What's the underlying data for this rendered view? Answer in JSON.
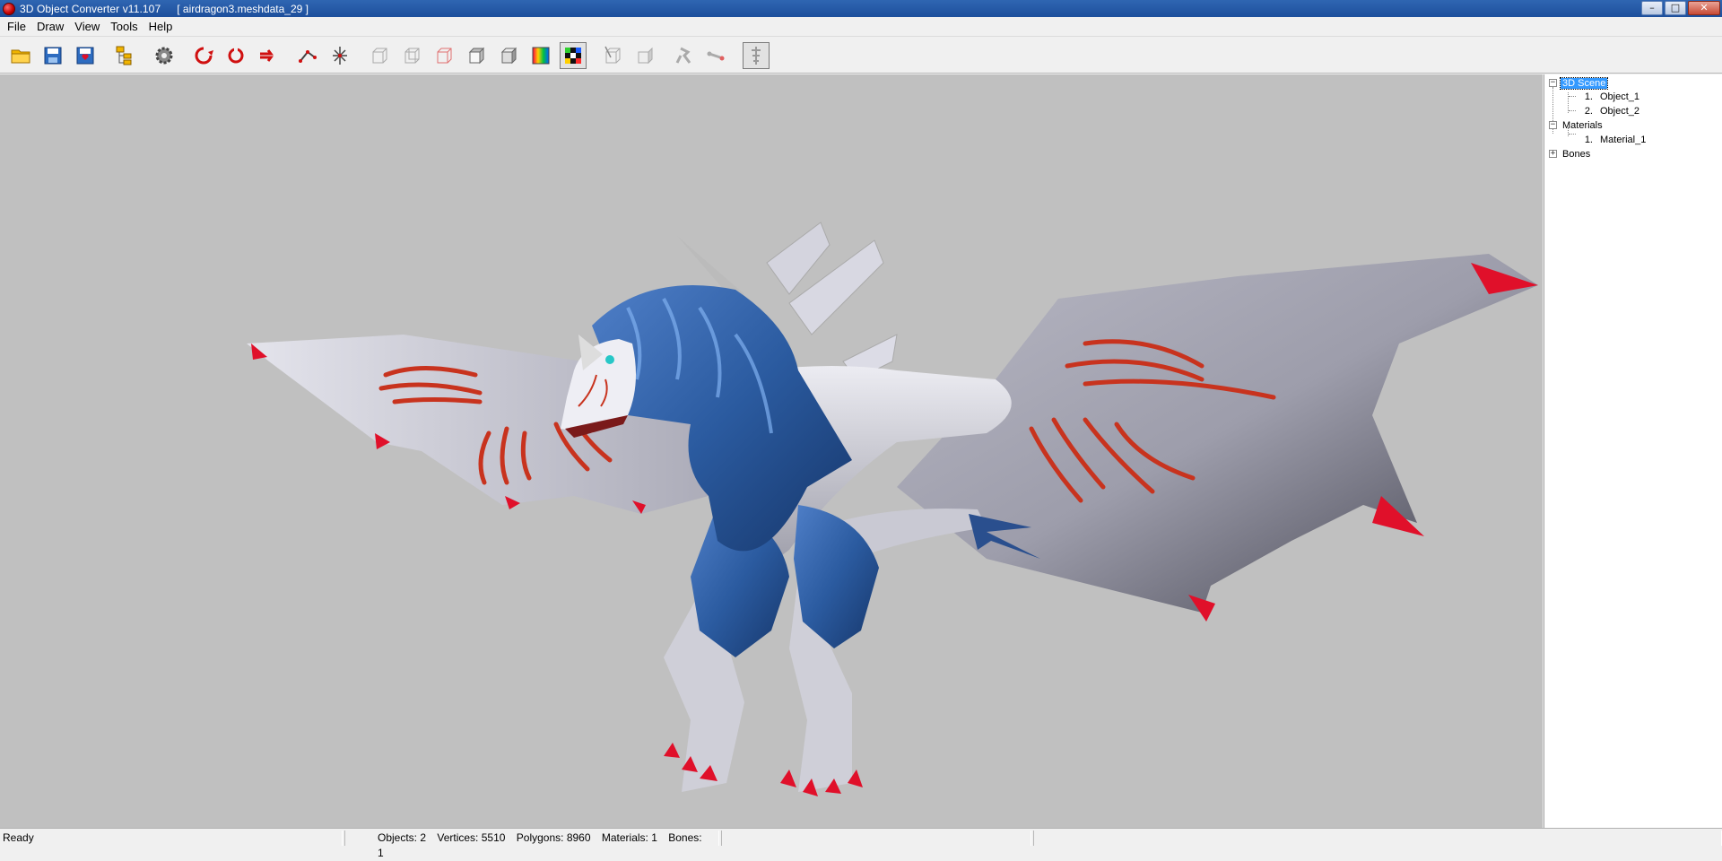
{
  "window": {
    "title": "3D Object Converter v11.107",
    "file": "[ airdragon3.meshdata_29 ]",
    "controls": {
      "minimize": "–",
      "maximize": "□",
      "close": "✕"
    }
  },
  "menu": [
    "File",
    "Draw",
    "View",
    "Tools",
    "Help"
  ],
  "toolbar": [
    {
      "name": "open-folder-icon",
      "active": false
    },
    {
      "name": "save-icon",
      "active": false
    },
    {
      "name": "save-as-icon",
      "active": false
    },
    {
      "name": "scene-tree-icon",
      "active": false
    },
    {
      "name": "settings-gear-icon",
      "active": false
    },
    {
      "name": "rotate-x-icon",
      "active": false
    },
    {
      "name": "rotate-y-icon",
      "active": false
    },
    {
      "name": "rotate-z-icon",
      "active": false
    },
    {
      "name": "vertices-icon",
      "active": false
    },
    {
      "name": "center-axes-icon",
      "active": false
    },
    {
      "name": "wireframe-front-icon",
      "active": false
    },
    {
      "name": "wireframe-side-icon",
      "active": false
    },
    {
      "name": "wireframe-red-icon",
      "active": false
    },
    {
      "name": "solid-cube-icon",
      "active": false
    },
    {
      "name": "shaded-cube-icon",
      "active": false
    },
    {
      "name": "color-cube-icon",
      "active": false
    },
    {
      "name": "texture-cube-icon",
      "active": true
    },
    {
      "name": "normals-icon",
      "active": false
    },
    {
      "name": "backface-icon",
      "active": false
    },
    {
      "name": "animation-icon",
      "active": false
    },
    {
      "name": "bone-icon",
      "active": false
    },
    {
      "name": "skeleton-icon",
      "active": true
    }
  ],
  "scene_tree": {
    "root": "3D Scene",
    "objects": [
      {
        "num": "1.",
        "label": "Object_1"
      },
      {
        "num": "2.",
        "label": "Object_2"
      }
    ],
    "materials_label": "Materials",
    "materials": [
      {
        "num": "1.",
        "label": "Material_1"
      }
    ],
    "bones_label": "Bones"
  },
  "status": {
    "state": "Ready",
    "objects": "Objects: 2",
    "vertices": "Vertices: 5510",
    "polygons": "Polygons: 8960",
    "materials": "Materials: 1",
    "bones": "Bones: 1"
  },
  "colors": {
    "viewport_bg": "#c0c0c0",
    "dragon_body": "#d9d9e2",
    "dragon_fur": "#2f5f9e",
    "claw_tips": "#e0102a",
    "wing_markings": "#c8331e"
  }
}
